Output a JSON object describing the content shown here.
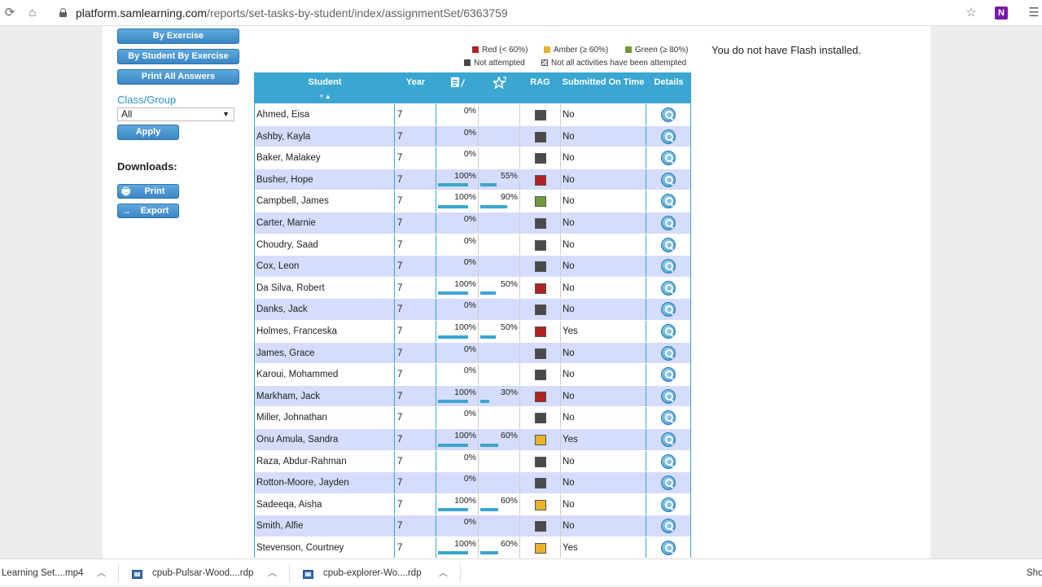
{
  "browser": {
    "url_host": "platform.samlearning.com",
    "url_path": "/reports/set-tasks-by-student/index/assignmentSet/6363759"
  },
  "sidebar": {
    "by_exercise": "By Exercise",
    "by_student_by_exercise": "By Student By Exercise",
    "print_all_answers": "Print All Answers",
    "class_group_label": "Class/Group",
    "class_group_value": "All",
    "apply": "Apply",
    "downloads_label": "Downloads:",
    "print": "Print",
    "export": "Export"
  },
  "legend": {
    "red": "Red (< 60%)",
    "amber": "Amber (≥ 60%)",
    "green": "Green (≥ 80%)",
    "not_attempted": "Not attempted",
    "not_all": "Not all activities have been attempted"
  },
  "flash_message": "You do not have Flash installed.",
  "colors": {
    "red": "#b22222",
    "amber": "#e8b22e",
    "green": "#6e9a3c",
    "grey": "#4a4a4a",
    "header": "#3aa6d1",
    "row_alt": "#d6dcfb"
  },
  "table": {
    "headers": {
      "student": "Student",
      "year": "Year",
      "completion_icon": "completion-icon",
      "score_icon": "star-score-icon",
      "rag": "RAG",
      "submitted": "Submitted On Time",
      "details": "Details"
    },
    "rows": [
      {
        "name": "Ahmed, Eisa",
        "year": "7",
        "completion": "0%",
        "score": "",
        "rag": "grey",
        "submitted": "No"
      },
      {
        "name": "Ashby, Kayla",
        "year": "7",
        "completion": "0%",
        "score": "",
        "rag": "grey",
        "submitted": "No"
      },
      {
        "name": "Baker, Malakey",
        "year": "7",
        "completion": "0%",
        "score": "",
        "rag": "grey",
        "submitted": "No"
      },
      {
        "name": "Busher, Hope",
        "year": "7",
        "completion": "100%",
        "score": "55%",
        "rag": "red",
        "submitted": "No"
      },
      {
        "name": "Campbell, James",
        "year": "7",
        "completion": "100%",
        "score": "90%",
        "rag": "green",
        "submitted": "No"
      },
      {
        "name": "Carter, Marnie",
        "year": "7",
        "completion": "0%",
        "score": "",
        "rag": "grey",
        "submitted": "No"
      },
      {
        "name": "Choudry, Saad",
        "year": "7",
        "completion": "0%",
        "score": "",
        "rag": "grey",
        "submitted": "No"
      },
      {
        "name": "Cox, Leon",
        "year": "7",
        "completion": "0%",
        "score": "",
        "rag": "grey",
        "submitted": "No"
      },
      {
        "name": "Da Silva, Robert",
        "year": "7",
        "completion": "100%",
        "score": "50%",
        "rag": "red",
        "submitted": "No"
      },
      {
        "name": "Danks, Jack",
        "year": "7",
        "completion": "0%",
        "score": "",
        "rag": "grey",
        "submitted": "No"
      },
      {
        "name": "Holmes, Franceska",
        "year": "7",
        "completion": "100%",
        "score": "50%",
        "rag": "red",
        "submitted": "Yes"
      },
      {
        "name": "James, Grace",
        "year": "7",
        "completion": "0%",
        "score": "",
        "rag": "grey",
        "submitted": "No"
      },
      {
        "name": "Karoui, Mohammed",
        "year": "7",
        "completion": "0%",
        "score": "",
        "rag": "grey",
        "submitted": "No"
      },
      {
        "name": "Markham, Jack",
        "year": "7",
        "completion": "100%",
        "score": "30%",
        "rag": "red",
        "submitted": "No"
      },
      {
        "name": "Miller, Johnathan",
        "year": "7",
        "completion": "0%",
        "score": "",
        "rag": "grey",
        "submitted": "No"
      },
      {
        "name": "Onu Amula, Sandra",
        "year": "7",
        "completion": "100%",
        "score": "60%",
        "rag": "amber",
        "submitted": "Yes"
      },
      {
        "name": "Raza, Abdur-Rahman",
        "year": "7",
        "completion": "0%",
        "score": "",
        "rag": "grey",
        "submitted": "No"
      },
      {
        "name": "Rotton-Moore, Jayden",
        "year": "7",
        "completion": "0%",
        "score": "",
        "rag": "grey",
        "submitted": "No"
      },
      {
        "name": "Sadeeqa, Aisha",
        "year": "7",
        "completion": "100%",
        "score": "60%",
        "rag": "amber",
        "submitted": "No"
      },
      {
        "name": "Smith, Alfie",
        "year": "7",
        "completion": "0%",
        "score": "",
        "rag": "grey",
        "submitted": "No"
      },
      {
        "name": "Stevenson, Courtney",
        "year": "7",
        "completion": "100%",
        "score": "60%",
        "rag": "amber",
        "submitted": "Yes"
      }
    ]
  },
  "downloads_bar": {
    "items": [
      "Learning Set....mp4",
      "cpub-Pulsar-Wood....rdp",
      "cpub-explorer-Wo....rdp"
    ],
    "show_all": "Sho"
  }
}
